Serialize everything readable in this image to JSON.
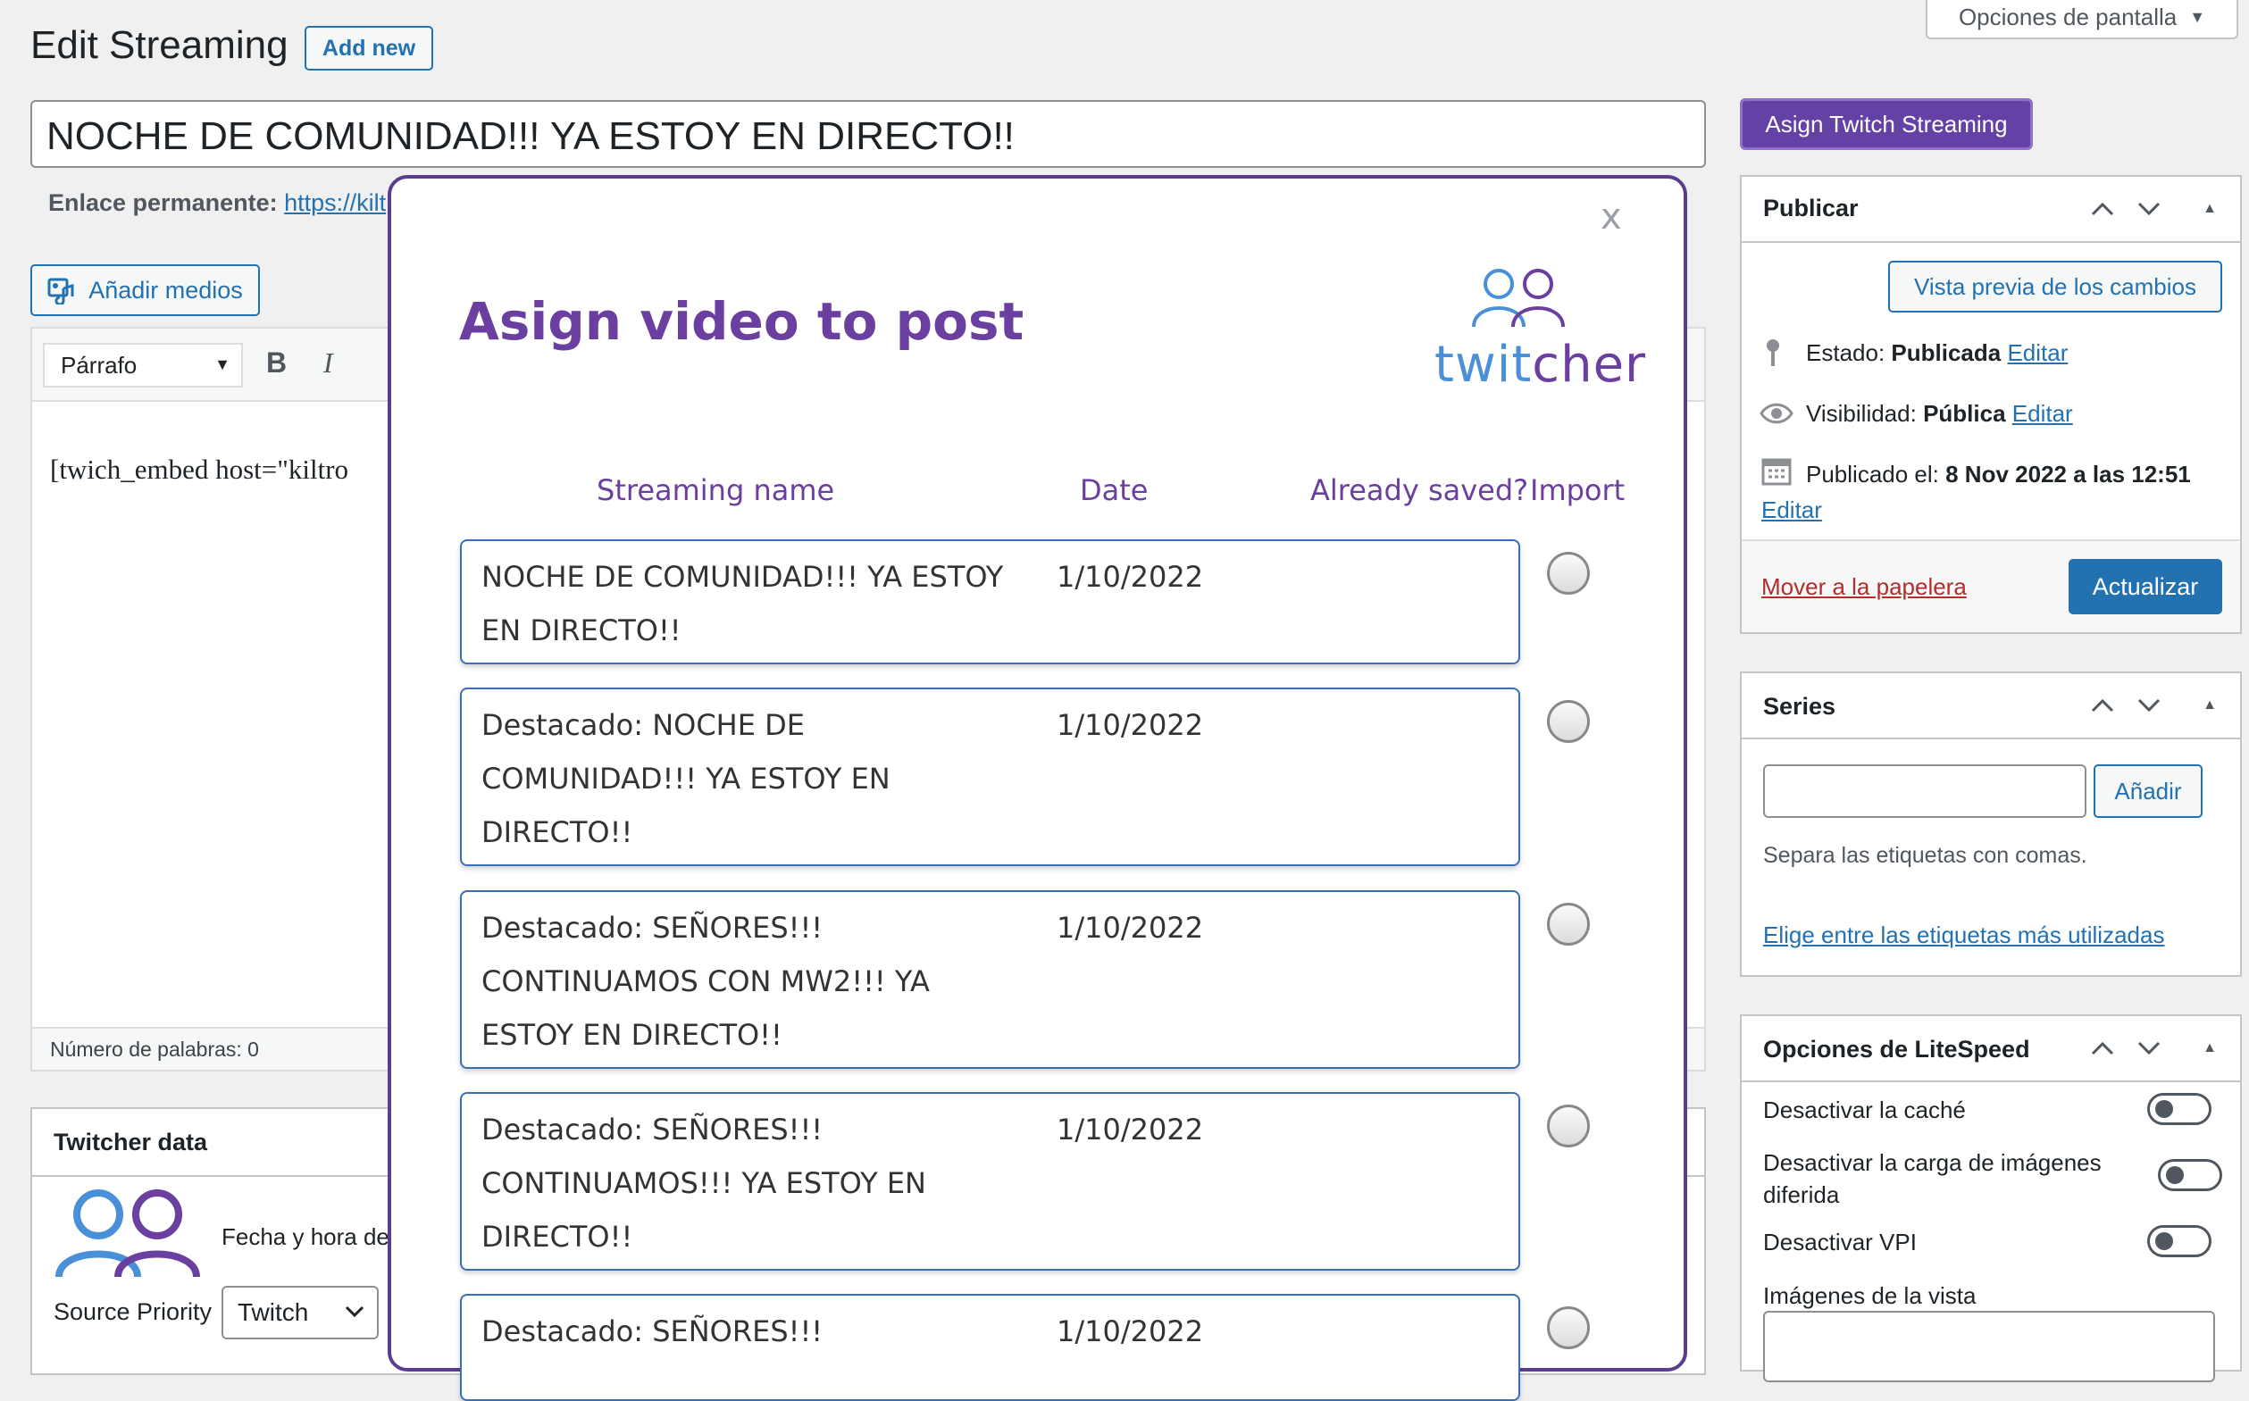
{
  "header": {
    "title": "Edit Streaming",
    "add_new": "Add new",
    "screen_options": "Opciones de pantalla"
  },
  "post": {
    "title_value": "NOCHE DE COMUNIDAD!!! YA ESTOY EN DIRECTO!!",
    "permalink_label": "Enlace permanente:",
    "permalink_url": "https://kilt",
    "add_media": "Añadir medios",
    "format_select": "Párrafo",
    "content": "[twich_embed host=\"kiltro",
    "word_count": "Número de palabras: 0"
  },
  "asign_button": "Asign Twitch Streaming",
  "twitcher_box": {
    "title": "Twitcher data",
    "date_label": "Fecha y hora de",
    "source_label": "Source Priority",
    "source_value": "Twitch"
  },
  "publish": {
    "title": "Publicar",
    "preview": "Vista previa de los cambios",
    "status_label": "Estado:",
    "status_value": "Publicada",
    "status_edit": "Editar",
    "visibility_label": "Visibilidad:",
    "visibility_value": "Pública",
    "visibility_edit": "Editar",
    "published_label": "Publicado el:",
    "published_value": "8 Nov 2022 a las 12:51",
    "published_edit": "Editar",
    "trash": "Mover a la papelera",
    "update": "Actualizar"
  },
  "series": {
    "title": "Series",
    "add": "Añadir",
    "help": "Separa las etiquetas con comas.",
    "choose": "Elige entre las etiquetas más utilizadas"
  },
  "litespeed": {
    "title": "Opciones de LiteSpeed",
    "opt1": "Desactivar la caché",
    "opt2": "Desactivar la carga de imágenes diferida",
    "opt3": "Desactivar VPI",
    "opt4": "Imágenes de la vista"
  },
  "modal": {
    "close": "x",
    "title": "Asign video to post",
    "logo_text_a": "twit",
    "logo_text_b": "cher",
    "col_name": "Streaming name",
    "col_date": "Date",
    "col_saved": "Already saved?",
    "col_import": "Import",
    "rows": [
      {
        "name": "NOCHE DE COMUNIDAD!!! YA ESTOY EN DIRECTO!!",
        "date": "1/10/2022"
      },
      {
        "name": "Destacado: NOCHE DE COMUNIDAD!!! YA ESTOY EN DIRECTO!!",
        "date": "1/10/2022"
      },
      {
        "name": "Destacado: SEÑORES!!! CONTINUAMOS CON MW2!!! YA ESTOY EN DIRECTO!!",
        "date": "1/10/2022"
      },
      {
        "name": "Destacado: SEÑORES!!! CONTINUAMOS!!! YA ESTOY EN DIRECTO!!",
        "date": "1/10/2022"
      },
      {
        "name": "Destacado: SEÑORES!!!",
        "date": "1/10/2022"
      }
    ]
  },
  "colors": {
    "wp_blue": "#2271b1",
    "twitch_purple": "#6a3fa0",
    "card_border": "#3a6fb5"
  }
}
